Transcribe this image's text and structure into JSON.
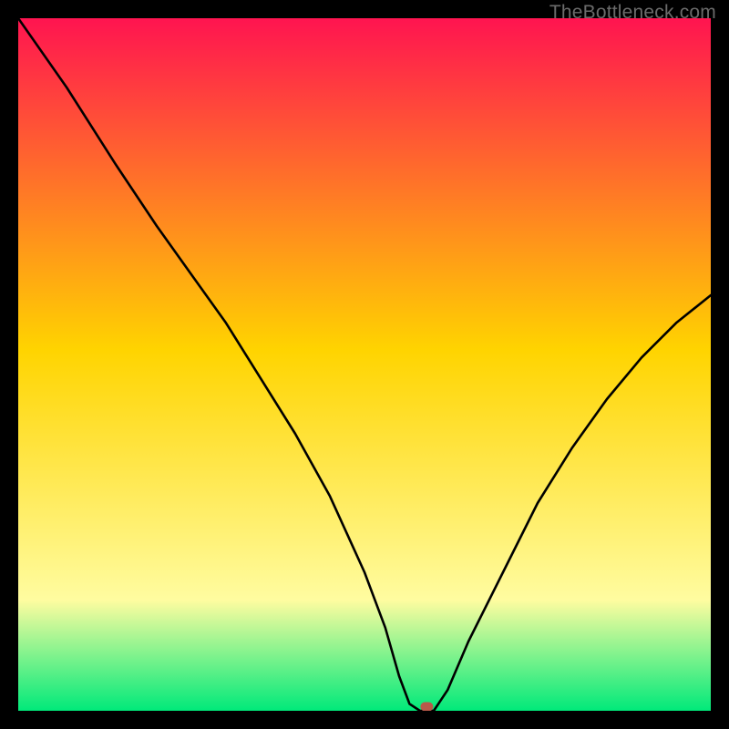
{
  "watermark": "TheBottleneck.com",
  "chart_data": {
    "type": "line",
    "title": "",
    "xlabel": "",
    "ylabel": "",
    "xlim": [
      0,
      100
    ],
    "ylim": [
      0,
      100
    ],
    "grid": false,
    "legend": false,
    "gradient_background": {
      "top_color": "#ff1450",
      "mid_color": "#ffd400",
      "lower_mid_color": "#fffca0",
      "bottom_color": "#00e97a"
    },
    "series": [
      {
        "name": "bottleneck-curve",
        "color": "#000000",
        "x": [
          0,
          7,
          14,
          20,
          25,
          30,
          35,
          40,
          45,
          50,
          53,
          55,
          56.5,
          58,
          60,
          62,
          65,
          70,
          75,
          80,
          85,
          90,
          95,
          100
        ],
        "y": [
          100,
          90,
          79,
          70,
          63,
          56,
          48,
          40,
          31,
          20,
          12,
          5,
          1,
          0,
          0,
          3,
          10,
          20,
          30,
          38,
          45,
          51,
          56,
          60
        ]
      }
    ],
    "marker": {
      "name": "optimal-point",
      "x": 59,
      "y": 0.6,
      "color": "#b85a4a",
      "shape": "pill"
    }
  }
}
